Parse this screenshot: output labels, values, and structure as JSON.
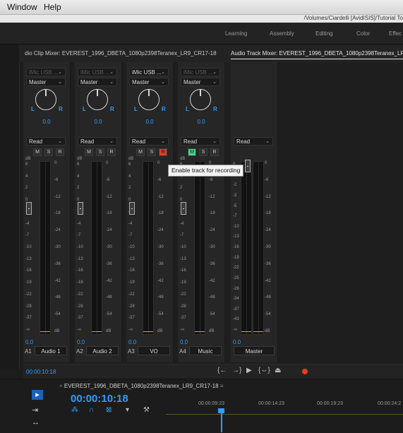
{
  "menubar": {
    "items": [
      "Window",
      "Help"
    ]
  },
  "path": "/Volumes/Ciardelli [AvidISIS]/Tutorial To",
  "workspace_tabs": [
    "Learning",
    "Assembly",
    "Editing",
    "Color",
    "Effec"
  ],
  "panel_tabs": {
    "clip_mixer": "dio Clip Mixer: EVEREST_1996_DBETA_1080p2398Teranex_LR9_CR17-18",
    "track_mixer": "Audio Track Mixer: EVEREST_1996_DBETA_1080p2398Teranex_LR9_"
  },
  "colors": {
    "accent": "#2e9bff",
    "record_red": "#e23b2a",
    "monitor_green": "#43d88a"
  },
  "strips": [
    {
      "input": "iMic USB ...",
      "input_dim": true,
      "output": "Master",
      "pan_value": "0.0",
      "automation": "Read",
      "volume": "0.0",
      "track_no": "A1",
      "name": "Audio 1",
      "record_on": false,
      "monitor_on": false
    },
    {
      "input": "iMic USB ...",
      "input_dim": true,
      "output": "Master",
      "pan_value": "0.0",
      "automation": "Read",
      "volume": "0.0",
      "track_no": "A2",
      "name": "Audio 2",
      "record_on": false,
      "monitor_on": false
    },
    {
      "input": "iMic USB ...",
      "input_dim": false,
      "output": "Master",
      "pan_value": "0.0",
      "automation": "Read",
      "volume": "0.0",
      "track_no": "A3",
      "name": "VO",
      "record_on": true,
      "monitor_on": false
    },
    {
      "input": "iMic USB ...",
      "input_dim": true,
      "output": "Master",
      "pan_value": "0.0",
      "automation": "Read",
      "volume": "0.0",
      "track_no": "A4",
      "name": "Music",
      "record_on": false,
      "monitor_on": true
    }
  ],
  "master": {
    "automation": "Read",
    "volume": "0.0",
    "name": "Master"
  },
  "labels": {
    "L": "L",
    "R": "R",
    "M": "M",
    "S": "S",
    "Rbtn": "R",
    "dB": "dB"
  },
  "meter_scale": [
    "6",
    "4",
    "2",
    "0",
    "-2",
    "-4",
    "-7",
    "-10",
    "-13",
    "-16",
    "-19",
    "-22",
    "-28",
    "-37",
    "-∞"
  ],
  "master_scale": [
    "0",
    "-1",
    "-2",
    "-3",
    "-5",
    "-7",
    "-10",
    "-13",
    "-16",
    "-19",
    "-22",
    "-25",
    "-28",
    "-34",
    "-37",
    "-43",
    "-∞"
  ],
  "fader_scale": [
    "0",
    "-6",
    "-12",
    "-18",
    "-24",
    "-30",
    "-36",
    "-42",
    "-48",
    "-54",
    "dB"
  ],
  "tooltip": "Enable track for recording",
  "transport": {
    "timecode": "00:00:10:18",
    "controls": [
      "{←",
      "→}",
      "▶",
      "{⇔}",
      "⏏"
    ]
  },
  "sequence": {
    "name": "EVEREST_1996_DBETA_1080p2398Teranex_LR9_CR17-18",
    "timecode": "00:00:10:18",
    "ruler": [
      "00:00:09:23",
      "00:00:14:23",
      "00:00:19:23",
      "00:00:24:2"
    ]
  }
}
